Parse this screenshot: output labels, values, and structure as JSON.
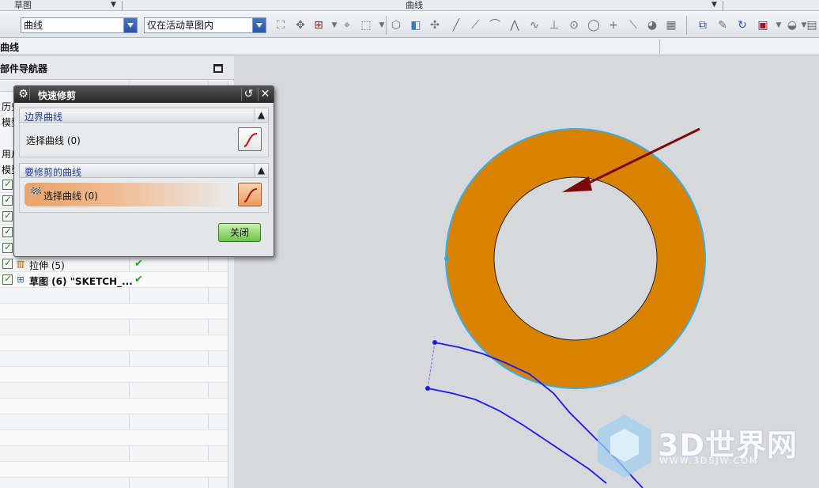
{
  "groupbar": {
    "group_sketch": "草图",
    "group_curve": "曲线"
  },
  "toolbar": {
    "filter_combo_value": "曲线",
    "scope_combo_value": "仅在活动草图内"
  },
  "subbar": {
    "title": "曲线"
  },
  "navigator": {
    "title": "部件导航器",
    "side_labels": [
      "历史",
      "模型",
      "用户",
      "模型"
    ],
    "features": [
      {
        "name": "拉伸 (5)",
        "bold": false,
        "icon": "extrude-icon",
        "ok": true
      },
      {
        "name": "草图 (6) \"SKETCH_...",
        "bold": true,
        "icon": "sketch-icon",
        "ok": true
      }
    ]
  },
  "dialog": {
    "title": "快速修剪",
    "section_boundary": {
      "header": "边界曲线",
      "select_label": "选择曲线 (0)"
    },
    "section_trim": {
      "header": "要修剪的曲线",
      "select_label": "选择曲线 (0)"
    },
    "close_label": "关闭"
  },
  "watermark": {
    "brand": "3D世界网",
    "url": "WWW.3DSJW.COM"
  },
  "colors": {
    "ring_fill": "#d98200",
    "ring_edge": "#3aaee0",
    "curve_blue": "#1a1aee",
    "arrow": "#7a0a0a",
    "dialog_title": "#2b2b2b",
    "close_button": "#6cc24a"
  }
}
